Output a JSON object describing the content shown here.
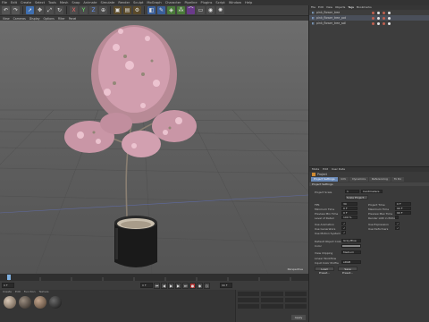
{
  "app": {
    "title": "CINEMA 4D"
  },
  "menubar": [
    "File",
    "Edit",
    "Create",
    "Select",
    "Tools",
    "Mesh",
    "Snap",
    "Animate",
    "Simulate",
    "Render",
    "Sculpt",
    "MoGraph",
    "Character",
    "Pipeline",
    "Plugins",
    "Script",
    "Window",
    "Help"
  ],
  "viewport_menu": [
    "View",
    "Cameras",
    "Display",
    "Options",
    "Filter",
    "Panel"
  ],
  "viewport_label": "Perspective",
  "objects": {
    "tabs": [
      "File",
      "Edit",
      "View",
      "Objects",
      "Tags",
      "Bookmarks"
    ],
    "rows": [
      {
        "name": "pink_flower_tree",
        "selected": false
      },
      {
        "name": "pink_flower_tree_pot",
        "selected": true
      },
      {
        "name": "pink_flower_tree_soil",
        "selected": false
      }
    ]
  },
  "attributes": {
    "menu": [
      "Mode",
      "Edit",
      "User Data"
    ],
    "header": "Project",
    "tabs": [
      "Project Settings",
      "Info",
      "Dynamics",
      "Referencing",
      "To Do"
    ],
    "section": "Project Settings",
    "scale_label": "Project Scale",
    "scale_value": "1",
    "scale_unit": "Centimeters",
    "scale_button": "Scale Project...",
    "left_fields": [
      {
        "label": "FPS",
        "value": "30"
      },
      {
        "label": "Minimum Time",
        "value": "0 F"
      },
      {
        "label": "Preview Min Time",
        "value": "0 F"
      },
      {
        "label": "Level of Detail",
        "value": "100 %"
      }
    ],
    "right_fields": [
      {
        "label": "Project Time",
        "value": "0 F"
      },
      {
        "label": "Maximum Time",
        "value": "90 F"
      },
      {
        "label": "Preview Max Time",
        "value": "90 F"
      },
      {
        "label": "Render LOD in Editor",
        "value": ""
      }
    ],
    "checks_left": [
      "Use Animation",
      "Use Generators",
      "Use Motion System"
    ],
    "checks_right": [
      "Use Expression",
      "Use Deformers"
    ],
    "default_color_label": "Default Object Color",
    "default_color_value": "Gray-Blue",
    "color_label": "Color",
    "view_clipping_label": "View Clipping",
    "view_clipping_value": "Medium",
    "linear_workflow_label": "Linear Workflow",
    "input_color_label": "Input Color Profile",
    "input_color_value": "sRGB",
    "load_preset": "Load Preset...",
    "save_preset": "Save Preset..."
  },
  "transport": {
    "frame_start": "0 F",
    "frame_end": "90 F",
    "current": "0 F"
  },
  "materials": {
    "menu": [
      "Create",
      "Edit",
      "Function",
      "Texture"
    ],
    "label": "Mat"
  },
  "coords": {
    "apply": "Apply"
  }
}
